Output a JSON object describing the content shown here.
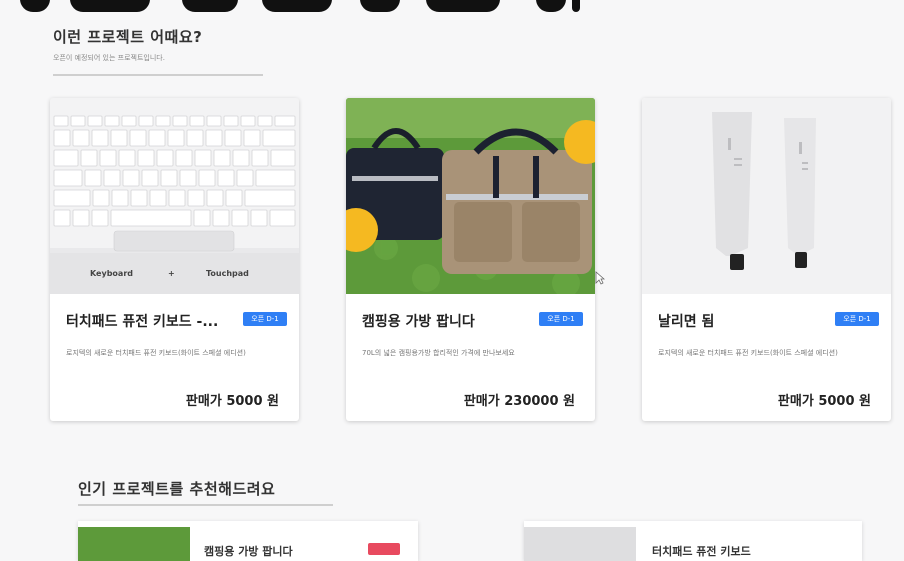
{
  "section_recommend": {
    "title": "이런 프로젝트 어때요?",
    "subtitle": "오픈이 예정되어 있는 프로젝트입니다."
  },
  "cards": [
    {
      "title": "터치패드 퓨전 키보드 -...",
      "badge": "오픈 D-1",
      "description": "로지텍의 새로운 터치패드 퓨전 키보드(화이트 스페셜 에디션)",
      "price": "판매가 5000 원",
      "image_labels": [
        "Keyboard",
        "+",
        "Touchpad"
      ]
    },
    {
      "title": "캠핑용 가방 팝니다",
      "badge": "오픈 D-1",
      "description": "70L의 넓은 캠핑용가방 합리적인 가격에 만나보세요",
      "price": "판매가 230000 원"
    },
    {
      "title": "날리면 됨",
      "badge": "오픈 D-1",
      "description": "로지텍의 새로운 터치패드 퓨전 키보드(화이트 스페셜 에디션)",
      "price": "판매가 5000 원"
    }
  ],
  "section_popular": {
    "title": "인기 프로젝트를 추천해드려요"
  },
  "popular_items": [
    {
      "title": "캠핑용 가방 팝니다"
    },
    {
      "title": "터치패드 퓨전 키보드"
    }
  ],
  "colors": {
    "badge": "#2f7ff5",
    "hot_badge": "#e84a5f",
    "background": "#f7f7f8",
    "card": "#ffffff"
  }
}
